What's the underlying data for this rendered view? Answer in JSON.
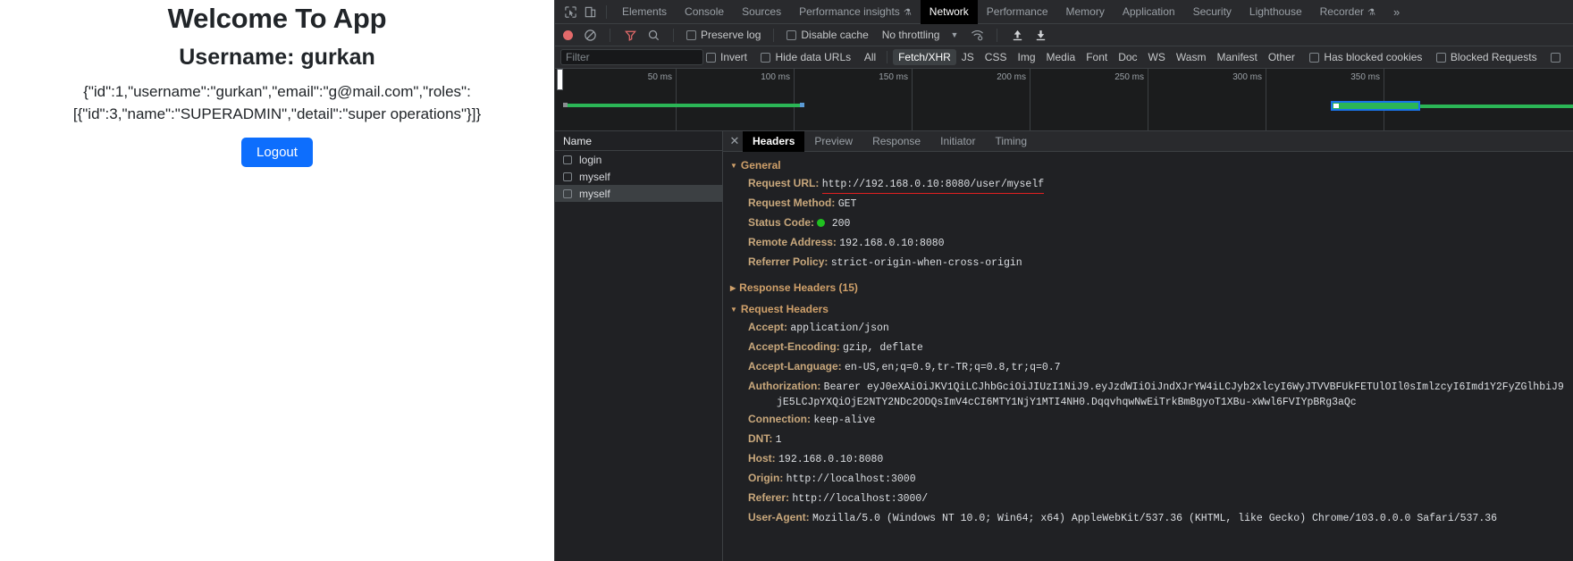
{
  "page": {
    "title": "Welcome To App",
    "username_line": "Username: gurkan",
    "json_payload": "{\"id\":1,\"username\":\"gurkan\",\"email\":\"g@mail.com\",\"roles\":[{\"id\":3,\"name\":\"SUPERADMIN\",\"detail\":\"super operations\"}]}",
    "logout_label": "Logout",
    "accent_color": "#0d6efd"
  },
  "devtools": {
    "main_tabs": [
      {
        "label": "Elements",
        "active": false
      },
      {
        "label": "Console",
        "active": false
      },
      {
        "label": "Sources",
        "active": false
      },
      {
        "label": "Performance insights",
        "active": false,
        "beaker": true
      },
      {
        "label": "Network",
        "active": true
      },
      {
        "label": "Performance",
        "active": false
      },
      {
        "label": "Memory",
        "active": false
      },
      {
        "label": "Application",
        "active": false
      },
      {
        "label": "Security",
        "active": false
      },
      {
        "label": "Lighthouse",
        "active": false
      },
      {
        "label": "Recorder",
        "active": false,
        "beaker": true
      }
    ],
    "more_tabs_label": "»",
    "inspect_icon": "inspect-element-icon",
    "device_icon": "device-toolbar-icon",
    "controls": {
      "record_label": "record-button",
      "clear_label": "clear-button",
      "filter_toggle_label": "filter-icon",
      "search_label": "search-icon",
      "preserve_log": "Preserve log",
      "disable_cache": "Disable cache",
      "throttling": "No throttling",
      "import_label": "import-har-icon",
      "export_label": "export-har-icon",
      "network_conditions_label": "network-conditions-icon"
    },
    "filters": {
      "placeholder": "Filter",
      "invert": "Invert",
      "hide_data_urls": "Hide data URLs",
      "types": [
        {
          "label": "All",
          "selected": false
        },
        {
          "label": "Fetch/XHR",
          "selected": true
        },
        {
          "label": "JS",
          "selected": false
        },
        {
          "label": "CSS",
          "selected": false
        },
        {
          "label": "Img",
          "selected": false
        },
        {
          "label": "Media",
          "selected": false
        },
        {
          "label": "Font",
          "selected": false
        },
        {
          "label": "Doc",
          "selected": false
        },
        {
          "label": "WS",
          "selected": false
        },
        {
          "label": "Wasm",
          "selected": false
        },
        {
          "label": "Manifest",
          "selected": false
        },
        {
          "label": "Other",
          "selected": false
        }
      ],
      "has_blocked_cookies": "Has blocked cookies",
      "blocked_requests": "Blocked Requests"
    },
    "overview": {
      "ticks": [
        "50 ms",
        "100 ms",
        "150 ms",
        "200 ms",
        "250 ms",
        "300 ms",
        "350 ms"
      ],
      "bar_color": "#2bb656",
      "selection_border": "#1a73e8"
    },
    "requests": {
      "column_header": "Name",
      "rows": [
        {
          "name": "login",
          "selected": false
        },
        {
          "name": "myself",
          "selected": false
        },
        {
          "name": "myself",
          "selected": true
        }
      ]
    },
    "detail_tabs": [
      {
        "label": "Headers",
        "active": true
      },
      {
        "label": "Preview",
        "active": false
      },
      {
        "label": "Response",
        "active": false
      },
      {
        "label": "Initiator",
        "active": false
      },
      {
        "label": "Timing",
        "active": false
      }
    ],
    "general": {
      "section_label": "General",
      "items": [
        {
          "key": "Request URL:",
          "value": "http://192.168.0.10:8080/user/myself",
          "underlined": true
        },
        {
          "key": "Request Method:",
          "value": "GET"
        },
        {
          "key": "Status Code:",
          "value": "200",
          "status_dot": true
        },
        {
          "key": "Remote Address:",
          "value": "192.168.0.10:8080"
        },
        {
          "key": "Referrer Policy:",
          "value": "strict-origin-when-cross-origin"
        }
      ]
    },
    "response_headers": {
      "section_label": "Response Headers (15)"
    },
    "request_headers": {
      "section_label": "Request Headers",
      "items": [
        {
          "key": "Accept:",
          "value": "application/json"
        },
        {
          "key": "Accept-Encoding:",
          "value": "gzip, deflate"
        },
        {
          "key": "Accept-Language:",
          "value": "en-US,en;q=0.9,tr-TR;q=0.8,tr;q=0.7"
        },
        {
          "key": "Authorization:",
          "value": "Bearer eyJ0eXAiOiJKV1QiLCJhbGciOiJIUzI1NiJ9.eyJzdWIiOiJndXJrYW4iLCJyb2xlcyI6WyJTVVBFUkFETUlOIl0sImlzcyI6Imd1Y2FyZGlhbiJ9",
          "wrap": "jE5LCJpYXQiOjE2NTY2NDc2ODQsImV4cCI6MTY1NjY1MTI4NH0.DqqvhqwNwEiTrkBmBgyoT1XBu-xWwl6FVIYpBRg3aQc",
          "arrow": true
        },
        {
          "key": "Connection:",
          "value": "keep-alive"
        },
        {
          "key": "DNT:",
          "value": "1"
        },
        {
          "key": "Host:",
          "value": "192.168.0.10:8080"
        },
        {
          "key": "Origin:",
          "value": "http://localhost:3000"
        },
        {
          "key": "Referer:",
          "value": "http://localhost:3000/"
        },
        {
          "key": "User-Agent:",
          "value": "Mozilla/5.0 (Windows NT 10.0; Win64; x64) AppleWebKit/537.36 (KHTML, like Gecko) Chrome/103.0.0.0 Safari/537.36"
        }
      ]
    }
  }
}
